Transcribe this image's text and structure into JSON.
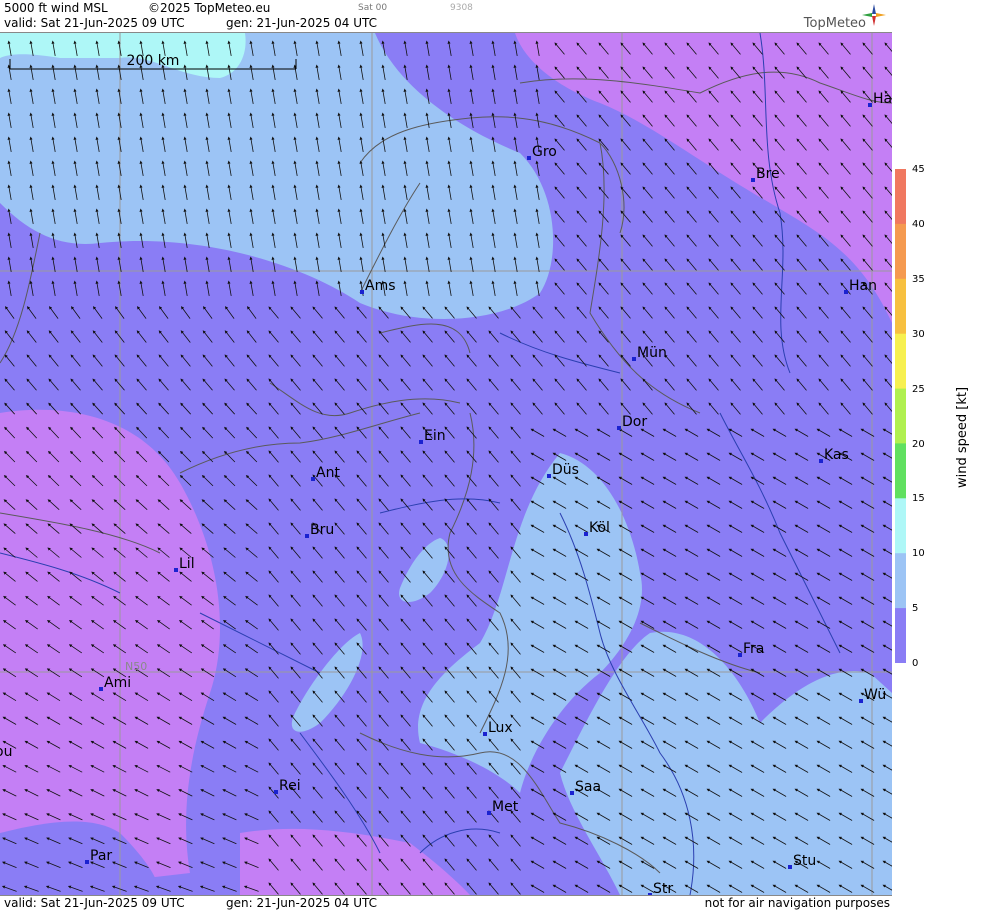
{
  "header": {
    "title": "5000 ft wind MSL",
    "copyright": "©2025 TopMeteo.eu",
    "time_code": "Sat 00",
    "code": "9308",
    "valid": "valid:  Sat  21-Jun-2025  09 UTC",
    "gen": "gen:  21-Jun-2025  04 UTC",
    "brand": "TopMeteo"
  },
  "footer": {
    "valid": "valid:  Sat  21-Jun-2025  09 UTC",
    "gen": "gen:  21-Jun-2025  04 UTC",
    "disclaimer": "not for air navigation purposes"
  },
  "map": {
    "scale_label": "200 km",
    "latitude_label": "N50",
    "cities": [
      {
        "name": "Gro"
      },
      {
        "name": "Bre"
      },
      {
        "name": "Ha"
      },
      {
        "name": "Ams"
      },
      {
        "name": "Han"
      },
      {
        "name": "Mün"
      },
      {
        "name": "Dor"
      },
      {
        "name": "Ein"
      },
      {
        "name": "Kas"
      },
      {
        "name": "Düs"
      },
      {
        "name": "Ant"
      },
      {
        "name": "Köl"
      },
      {
        "name": "Bru"
      },
      {
        "name": "Lil"
      },
      {
        "name": "Fra"
      },
      {
        "name": "Ami"
      },
      {
        "name": "Wü"
      },
      {
        "name": "ou"
      },
      {
        "name": "Lux"
      },
      {
        "name": "Rei"
      },
      {
        "name": "Saa"
      },
      {
        "name": "Met"
      },
      {
        "name": "Stu"
      },
      {
        "name": "Par"
      },
      {
        "name": "Str"
      }
    ],
    "colors": {
      "land_mid": "#8a7df5",
      "land_low": "#c47ff5",
      "land_high": "#9cc4f5",
      "land_peak": "#aef7f7",
      "city_marker": "#1a22d0"
    }
  },
  "legend": {
    "title": "wind  speed  [kt]",
    "ticks": [
      "45",
      "40",
      "35",
      "30",
      "25",
      "20",
      "15",
      "10",
      "5",
      "0"
    ],
    "colors": [
      "#f07860",
      "#f59a50",
      "#f7c040",
      "#f7f050",
      "#b0f050",
      "#60e060",
      "#aef7f7",
      "#9cc4f5",
      "#8a7df5",
      "#c47ff5"
    ]
  }
}
